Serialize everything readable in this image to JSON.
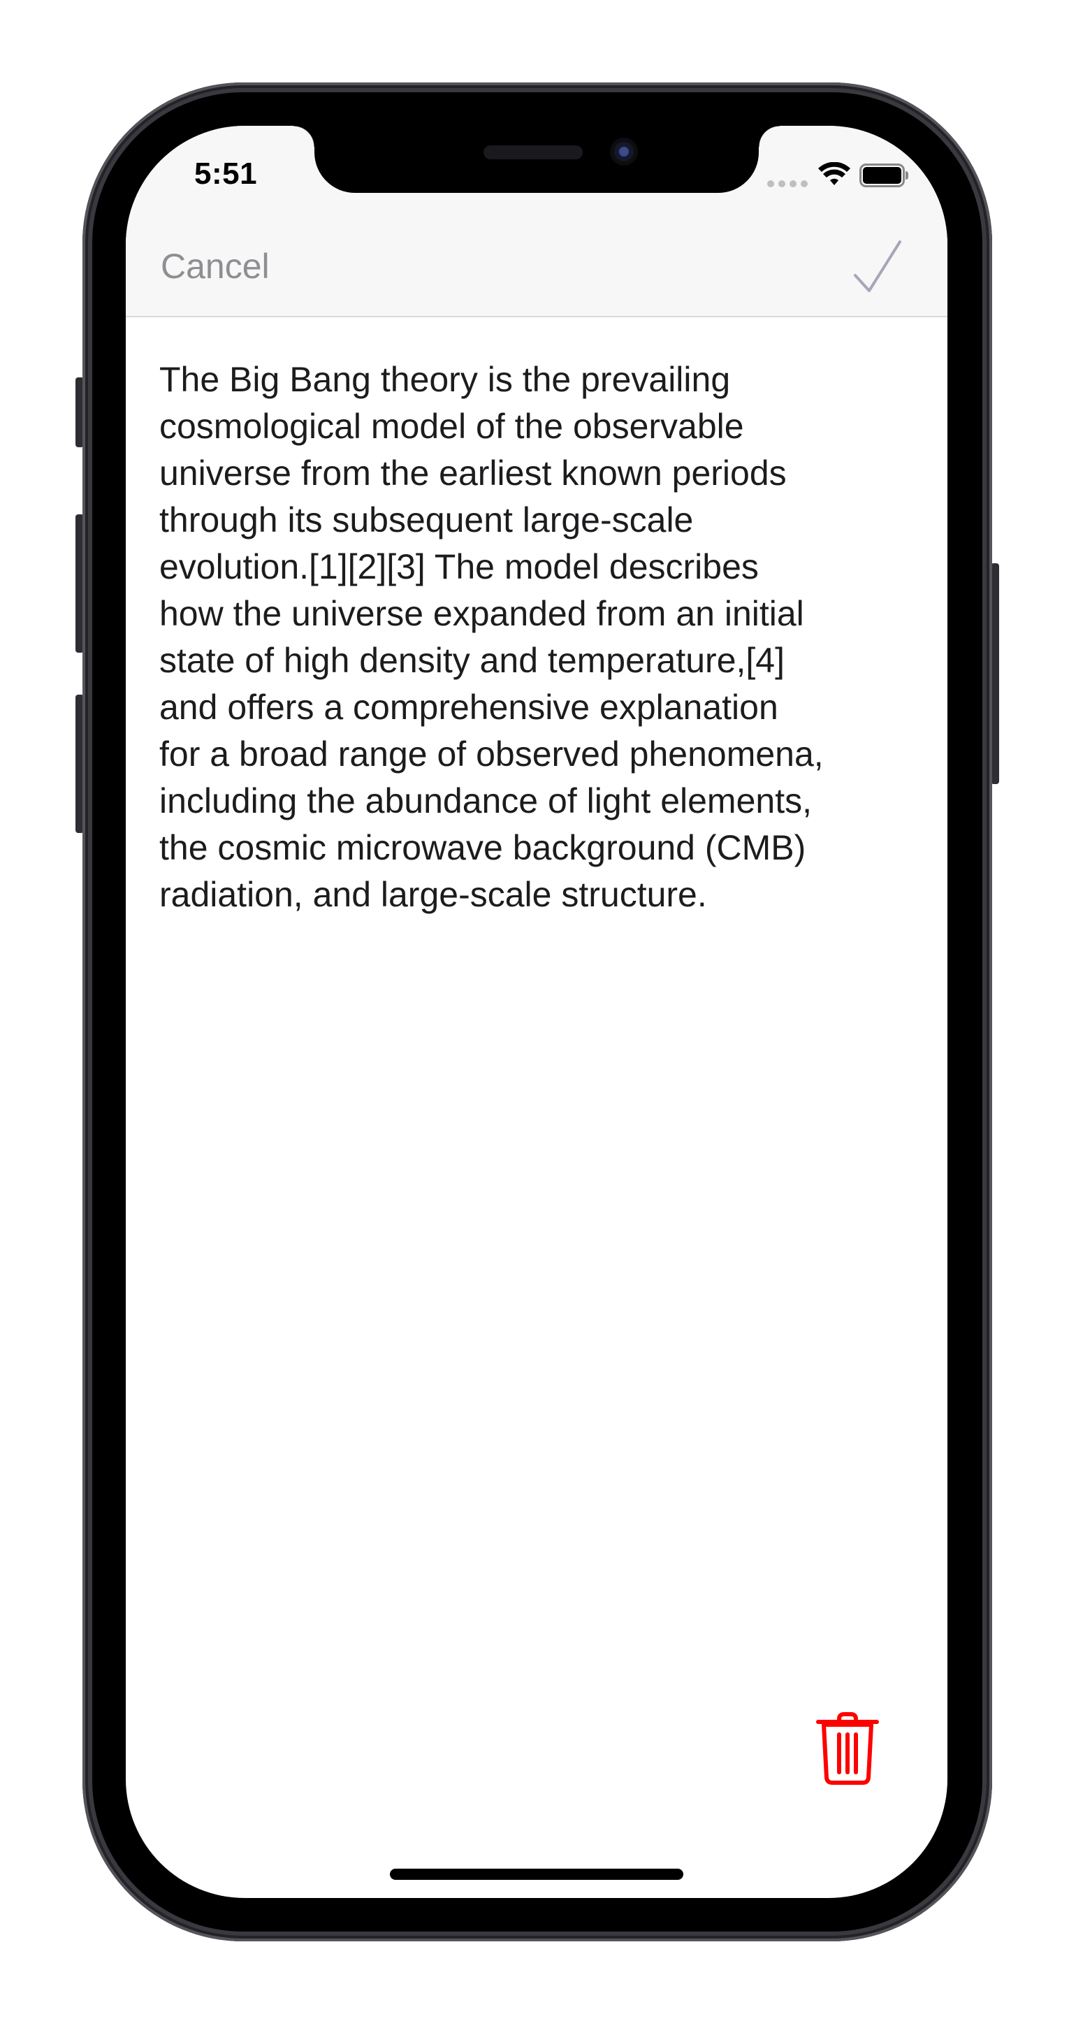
{
  "status_bar": {
    "time": "5:51",
    "signal_icon": "signal-dots-icon",
    "wifi_icon": "wifi-icon",
    "battery_icon": "battery-icon",
    "battery_level": 1.0
  },
  "nav_bar": {
    "cancel_label": "Cancel",
    "done_icon": "checkmark-icon"
  },
  "content": {
    "text": "The Big Bang theory is the prevailing\ncosmological model of the observable\nuniverse from the earliest known periods\nthrough its subsequent large-scale\nevolution.[1][2][3] The model describes\nhow the universe expanded from an initial\nstate of high density and temperature,[4]\nand offers a comprehensive explanation\nfor a broad range of observed phenomena,\nincluding the abundance of light elements,\nthe cosmic microwave background (CMB)\nradiation, and large-scale structure."
  },
  "toolbar": {
    "delete_icon": "trash-icon"
  },
  "colors": {
    "nav_background": "#f7f7f7",
    "cancel_text": "#8e8e93",
    "checkmark": "#a6a6b8",
    "trash": "#ff0000",
    "body_text": "#1c1c1e"
  }
}
